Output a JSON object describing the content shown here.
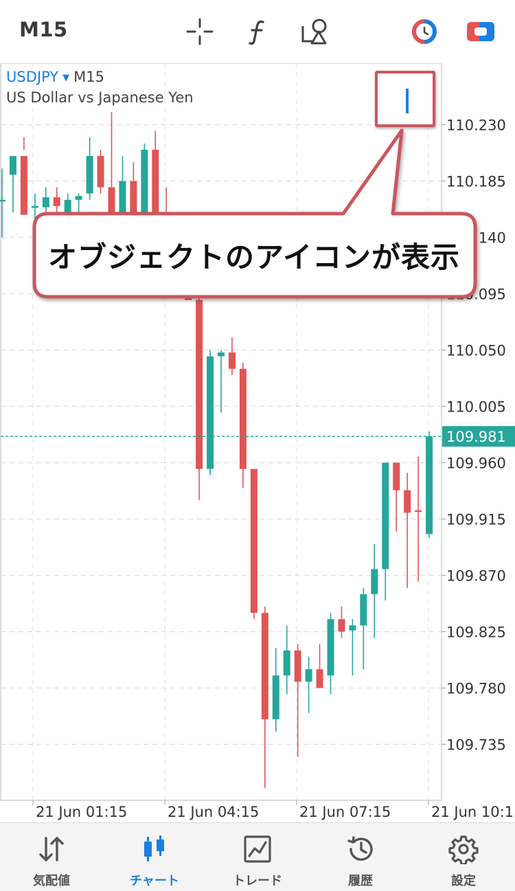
{
  "toolbar": {
    "timeframe": "M15",
    "icons": [
      "crosshair-icon",
      "indicator-f-icon",
      "objects-icon",
      "clock-icon",
      "trade-toggle-icon"
    ]
  },
  "chart_header": {
    "symbol": "USDJPY",
    "timeframe": "M15",
    "description": "US Dollar vs Japanese Yen"
  },
  "callout": {
    "text": "オブジェクトのアイコンが表示"
  },
  "colors": {
    "bull": "#26a69a",
    "bear": "#e05555",
    "accent": "#1a7fe0",
    "callout_border": "#c9575e"
  },
  "chart_data": {
    "type": "candlestick",
    "symbol": "USDJPY",
    "timeframe": "M15",
    "y_ticks": [
      "110.230",
      "110.185",
      "110.140",
      "110.095",
      "110.050",
      "110.005",
      "109.960",
      "109.915",
      "109.870",
      "109.825",
      "109.780",
      "109.735"
    ],
    "current_price": "109.981",
    "x_ticks": [
      "21 Jun 01:15",
      "21 Jun 04:15",
      "21 Jun 07:15",
      "21 Jun 10:1"
    ],
    "ylim": [
      109.7,
      110.268
    ],
    "candles": [
      [
        110.17,
        110.195,
        110.14,
        110.17
      ],
      [
        110.19,
        110.2,
        110.16,
        110.205
      ],
      [
        110.205,
        110.22,
        110.21,
        110.158
      ],
      [
        110.165,
        110.175,
        110.155,
        110.165
      ],
      [
        110.164,
        110.18,
        110.15,
        110.172
      ],
      [
        110.172,
        110.18,
        110.14,
        110.165
      ],
      [
        110.152,
        110.175,
        110.145,
        110.17
      ],
      [
        110.17,
        110.175,
        110.158,
        110.173
      ],
      [
        110.175,
        110.22,
        110.17,
        110.205
      ],
      [
        110.205,
        110.21,
        110.175,
        110.18
      ],
      [
        110.18,
        110.24,
        110.145,
        110.155
      ],
      [
        110.155,
        110.205,
        110.14,
        110.185
      ],
      [
        110.185,
        110.2,
        110.14,
        110.135
      ],
      [
        110.135,
        110.215,
        110.115,
        110.21
      ],
      [
        110.21,
        110.225,
        110.155,
        110.16
      ],
      [
        110.16,
        110.18,
        110.14,
        110.15
      ],
      [
        110.15,
        110.16,
        110.12,
        110.145
      ],
      [
        110.145,
        110.15,
        110.1,
        110.09
      ],
      [
        110.09,
        110.1,
        109.93,
        109.955
      ],
      [
        109.955,
        110.05,
        109.95,
        110.045
      ],
      [
        110.045,
        110.05,
        110.0,
        110.048
      ],
      [
        110.048,
        110.06,
        110.03,
        110.035
      ],
      [
        110.035,
        110.04,
        109.94,
        109.955
      ],
      [
        109.955,
        109.955,
        109.835,
        109.84
      ],
      [
        109.84,
        109.845,
        109.7,
        109.755
      ],
      [
        109.755,
        109.812,
        109.745,
        109.79
      ],
      [
        109.79,
        109.83,
        109.775,
        109.81
      ],
      [
        109.81,
        109.815,
        109.725,
        109.785
      ],
      [
        109.785,
        109.805,
        109.76,
        109.795
      ],
      [
        109.795,
        109.815,
        109.78,
        109.78
      ],
      [
        109.79,
        109.84,
        109.775,
        109.835
      ],
      [
        109.835,
        109.845,
        109.82,
        109.825
      ],
      [
        109.826,
        109.835,
        109.79,
        109.83
      ],
      [
        109.83,
        109.86,
        109.795,
        109.855
      ],
      [
        109.855,
        109.895,
        109.82,
        109.875
      ],
      [
        109.875,
        109.935,
        109.85,
        109.96
      ],
      [
        109.96,
        109.96,
        109.905,
        109.938
      ],
      [
        109.938,
        109.952,
        109.86,
        109.92
      ],
      [
        109.922,
        109.965,
        109.865,
        109.921
      ],
      [
        109.903,
        109.985,
        109.9,
        109.981
      ]
    ]
  },
  "bottom_nav": [
    {
      "label": "気配値",
      "icon": "quotes-arrows-icon",
      "active": false
    },
    {
      "label": "チャート",
      "icon": "chart-candles-icon",
      "active": true
    },
    {
      "label": "トレード",
      "icon": "trade-chart-icon",
      "active": false
    },
    {
      "label": "履歴",
      "icon": "history-clock-icon",
      "active": false
    },
    {
      "label": "設定",
      "icon": "settings-gear-icon",
      "active": false
    }
  ]
}
